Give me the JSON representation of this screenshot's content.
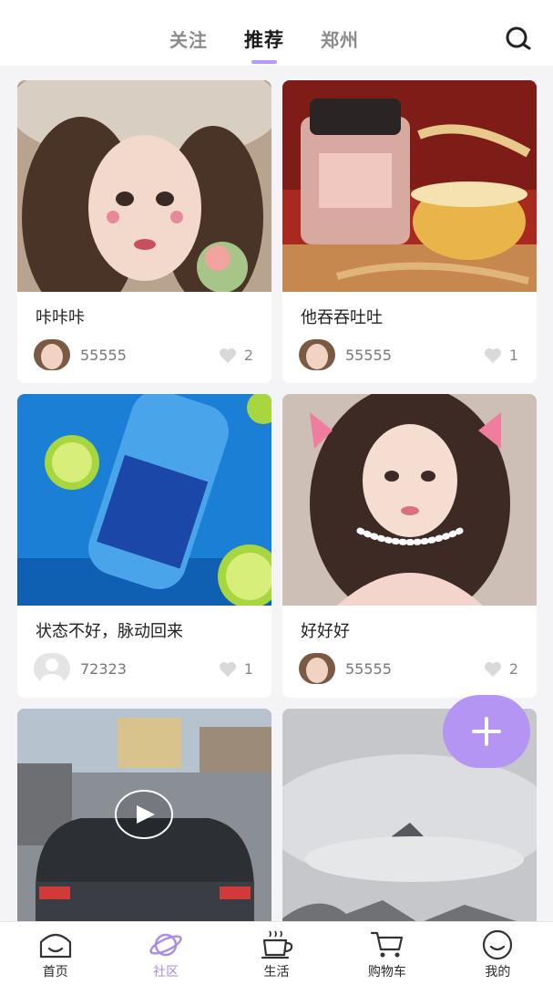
{
  "header": {
    "tabs": [
      {
        "label": "关注",
        "active": false
      },
      {
        "label": "推荐",
        "active": true
      },
      {
        "label": "郑州",
        "active": false
      }
    ],
    "search_icon": "search-icon"
  },
  "feed": {
    "cards": [
      {
        "title": "咔咔咔",
        "user": "55555",
        "likes": "2",
        "image": "girl-with-floral-face-paint-photo"
      },
      {
        "title": "他吞吞吐吐",
        "user": "55555",
        "likes": "1",
        "image": "ginseng-tea-jar-photo"
      },
      {
        "title": "状态不好，脉动回来",
        "user": "72323",
        "likes": "1",
        "image": "mizone-drink-bottle-with-limes-photo"
      },
      {
        "title": "好好好",
        "user": "55555",
        "likes": "2",
        "image": "girl-with-pink-bows-photo"
      },
      {
        "title": "",
        "user": "",
        "likes": "",
        "image": "traffic-street-video-thumbnail",
        "is_video": true
      },
      {
        "title": "",
        "user": "",
        "likes": "",
        "image": "misty-mountain-landscape-photo"
      }
    ]
  },
  "fab": {
    "icon": "plus-icon"
  },
  "bottom_nav": [
    {
      "label": "首页",
      "icon": "home-face-icon",
      "active": false
    },
    {
      "label": "社区",
      "icon": "planet-icon",
      "active": true
    },
    {
      "label": "生活",
      "icon": "coffee-cup-icon",
      "active": false
    },
    {
      "label": "购物车",
      "icon": "shopping-cart-icon",
      "active": false
    },
    {
      "label": "我的",
      "icon": "smiley-icon",
      "active": false
    }
  ],
  "colors": {
    "accent": "#b595f3",
    "nav_active": "#a98ae8",
    "background": "#f4f4f6"
  }
}
